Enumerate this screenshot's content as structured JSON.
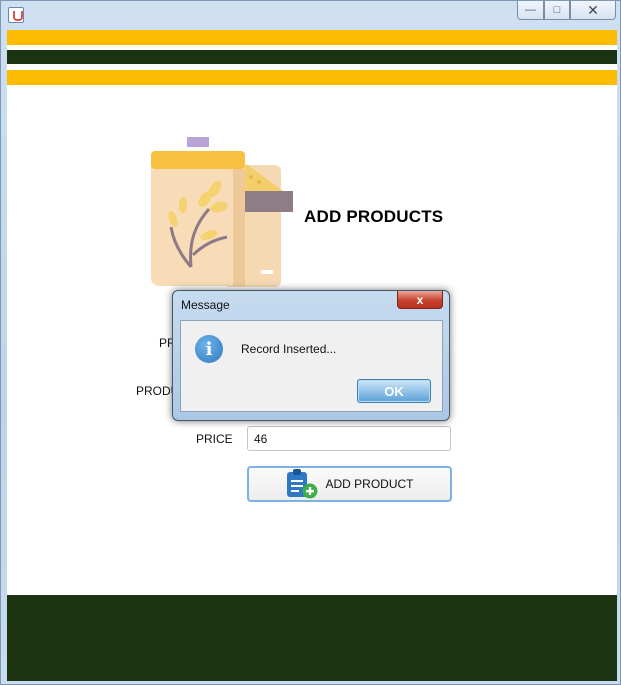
{
  "window": {
    "title": ""
  },
  "colors": {
    "accent_yellow": "#fbbb00",
    "dark_green": "#1a3310"
  },
  "page": {
    "title": "ADD PRODUCTS",
    "hero_icon": "grain-sack-icon"
  },
  "form": {
    "label_partial_1": "PR",
    "label_partial_2": "PRODU",
    "price_label": "PRICE",
    "price_value": "46",
    "add_button_label": "ADD PRODUCT",
    "add_button_icon": "clipboard-add-icon"
  },
  "dialog": {
    "title": "Message",
    "close_label": "x",
    "icon": "info-icon",
    "message": "Record Inserted...",
    "ok_label": "OK"
  }
}
